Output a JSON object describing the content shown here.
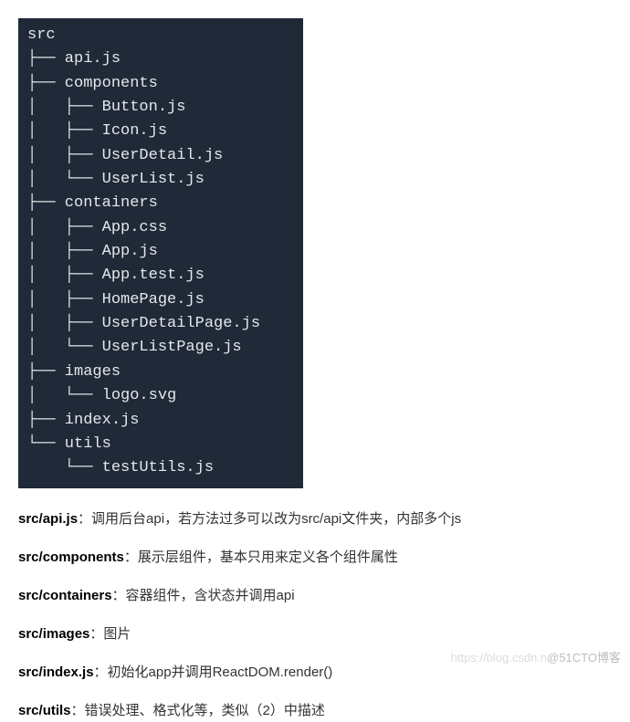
{
  "tree": {
    "lines": [
      "src",
      "├── api.js",
      "├── components",
      "│   ├── Button.js",
      "│   ├── Icon.js",
      "│   ├── UserDetail.js",
      "│   └── UserList.js",
      "├── containers",
      "│   ├── App.css",
      "│   ├── App.js",
      "│   ├── App.test.js",
      "│   ├── HomePage.js",
      "│   ├── UserDetailPage.js",
      "│   └── UserListPage.js",
      "├── images",
      "│   └── logo.svg",
      "├── index.js",
      "└── utils",
      "    └── testUtils.js"
    ]
  },
  "descriptions": [
    {
      "term": "src/api.js",
      "text": "：调用后台api，若方法过多可以改为src/api文件夹，内部多个js"
    },
    {
      "term": "src/components",
      "text": "：展示层组件，基本只用来定义各个组件属性"
    },
    {
      "term": "src/containers",
      "text": "：容器组件，含状态并调用api"
    },
    {
      "term": "src/images",
      "text": "：图片"
    },
    {
      "term": "src/index.js",
      "text": "：初始化app并调用ReactDOM.render()"
    },
    {
      "term": "src/utils",
      "text": "：错误处理、格式化等，类似（2）中描述"
    }
  ],
  "watermark": {
    "faint": "https://blog.csdn.n",
    "main": "@51CTO博客"
  }
}
